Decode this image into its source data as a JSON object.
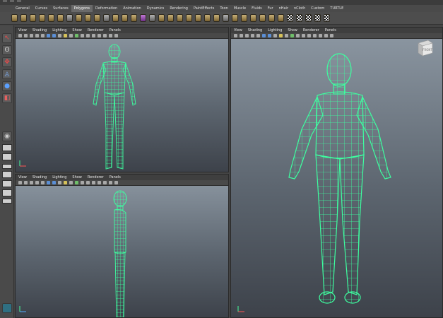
{
  "shelf": {
    "tabs": [
      {
        "label": "General"
      },
      {
        "label": "Curves"
      },
      {
        "label": "Surfaces"
      },
      {
        "label": "Polygons",
        "active": true
      },
      {
        "label": "Deformation"
      },
      {
        "label": "Animation"
      },
      {
        "label": "Dynamics"
      },
      {
        "label": "Rendering"
      },
      {
        "label": "PaintEffects"
      },
      {
        "label": "Toon"
      },
      {
        "label": "Muscle"
      },
      {
        "label": "Fluids"
      },
      {
        "label": "Fur"
      },
      {
        "label": "nHair"
      },
      {
        "label": "nCloth"
      },
      {
        "label": "Custom"
      },
      {
        "label": "TURTLE"
      }
    ]
  },
  "panel_menu": [
    "View",
    "Shading",
    "Lighting",
    "Show",
    "Renderer",
    "Panels"
  ],
  "viewports": {
    "top_left": {
      "menu": [
        "View",
        "Shading",
        "Lighting",
        "Show",
        "Renderer",
        "Panels"
      ]
    },
    "bottom_left": {
      "menu": [
        "View",
        "Shading",
        "Lighting",
        "Show",
        "Renderer",
        "Panels"
      ]
    },
    "right": {
      "menu": [
        "View",
        "Shading",
        "Lighting",
        "Show",
        "Renderer",
        "Panels"
      ],
      "view_cube": "FRONT"
    }
  },
  "colors": {
    "wireframe": "#3dffa0",
    "mesh_fill": "#3b3f3c",
    "accent_tab": "#6a6a6a"
  }
}
